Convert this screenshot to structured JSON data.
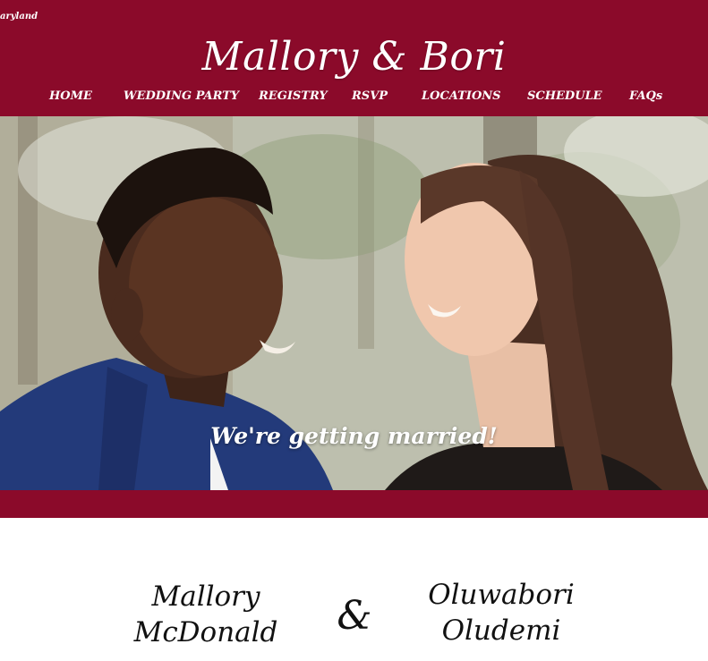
{
  "header": {
    "corner_text": "aryland",
    "title": "Mallory & Bori",
    "nav": [
      "HOME",
      "WEDDING PARTY",
      "REGISTRY",
      "RSVP",
      "LOCATIONS",
      "SCHEDULE",
      "FAQs"
    ]
  },
  "hero": {
    "caption": "We're getting married!"
  },
  "couple": {
    "left_first": "Mallory",
    "left_last": "McDonald",
    "ampersand": "&",
    "right_first": "Oluwabori",
    "right_last": "Oludemi"
  },
  "colors": {
    "brand": "#8b0a2a",
    "text_light": "#ffffff",
    "text_dark": "#111111"
  }
}
